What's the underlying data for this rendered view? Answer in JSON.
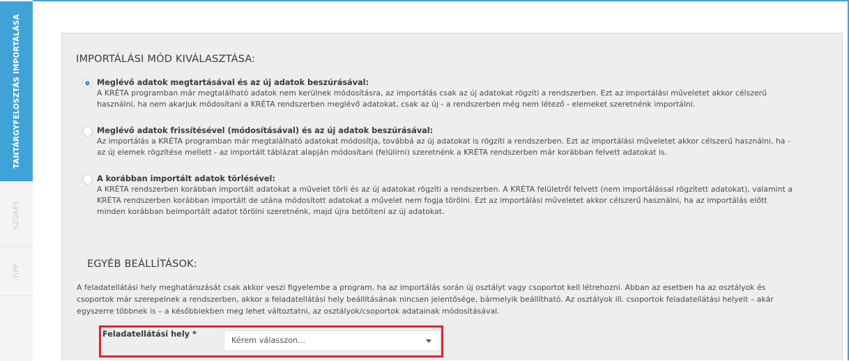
{
  "tabs": [
    {
      "label": "TANTÁRGYFELOSZTÁS IMPORTÁLÁSA",
      "active": true
    },
    {
      "label": "SZŰRÉS",
      "active": false
    },
    {
      "label": "TIPP",
      "active": false
    }
  ],
  "import_mode": {
    "heading": "IMPORTÁLÁSI MÓD KIVÁLASZTÁSA:",
    "options": [
      {
        "title": "Meglévő adatok megtartásával és az új adatok beszúrásával:",
        "desc_lines": [
          "A KRÉTA programban már megtalálható adatok nem kerülnek módosításra, az importálás csak az új adatokat rögzíti a rendszerben. Ezt az importálási műveletet akkor célszerű",
          "használni, ha nem akarjuk módosítani a KRÉTA rendszerben meglévő adatokat, csak az új - a rendszerben még nem létező - elemeket szeretnénk importálni."
        ],
        "checked": true
      },
      {
        "title": "Meglévő adatok frissítésével (módosításával) és az új adatok beszúrásával:",
        "desc_lines": [
          "Az importálás a KRÉTA programban már megtalálható adatokat módosítja, továbbá az új adatokat is rögzíti a rendszerben. Ezt az importálási műveletet akkor célszerű használni, ha -",
          "az új elemek rögzítése mellett - az importált táblázat alapján módosítani (felülírni) szeretnénk a KRÉTA rendszerben már korábban felvett adatokat is."
        ],
        "checked": false
      },
      {
        "title": "A korábban importált adatok törlésével:",
        "desc_lines": [
          "A KRÉTA rendszerben korábban importált adatokat a művelet törli és az új adatokat rögzíti a rendszerben. A KRÉTA felületről felvett (nem importálással rögzített adatokat), valamint a",
          "KRÉTA rendszerben korábban importált de utána módosított adatokat a művelet nem fogja törölni. Ezt az importálási műveletet akkor célszerű használni, ha az importálás előtt",
          "minden korábban beimportált adatot törölni szeretnénk, majd újra betölteni az új adatokat."
        ],
        "checked": false
      }
    ]
  },
  "other_settings": {
    "heading": "EGYÉB BEÁLLÍTÁSOK:",
    "info_lines": [
      "A feladatellátási hely meghatározását csak akkor veszi figyelembe a program, ha az importálás során új osztályt vagy csoportot kell létrehozni. Abban az esetben ha az osztályok és",
      "csoportok már szerepelnek a rendszerben, akkor a feladatellátási hely beállításának nincsen jelentősége, bármelyik beállítható. Az osztályok ill. csoportok feladatellátási helyeit – akár",
      "egyszerre többnek is – a későbbiekben meg lehet változtatni, az osztályok/csoportok adatainak módosításával."
    ],
    "field_label": "Feladatellátási hely *",
    "select_value": "Kérem válasszon...",
    "highlight_color": "#e0242e"
  },
  "colors": {
    "accent": "#3fa3d8",
    "panel_bg": "#eeeeee"
  }
}
